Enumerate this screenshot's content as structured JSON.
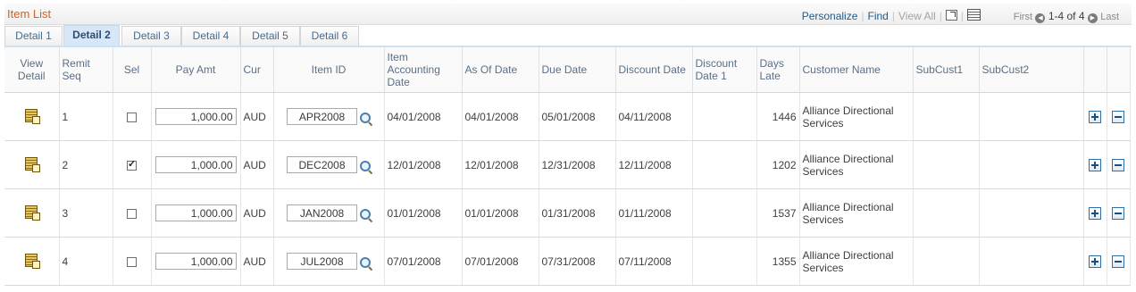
{
  "header": {
    "title": "Item List",
    "personalize": "Personalize",
    "find": "Find",
    "view_all": "View All",
    "first": "First",
    "range": "1-4 of 4",
    "last": "Last"
  },
  "tabs": [
    "Detail 1",
    "Detail 2",
    "Detail 3",
    "Detail 4",
    "Detail 5",
    "Detail 6"
  ],
  "active_tab": "Detail 2",
  "columns": {
    "view_detail": "View Detail",
    "remit_seq": "Remit Seq",
    "sel": "Sel",
    "pay_amt": "Pay Amt",
    "cur": "Cur",
    "item_id": "Item ID",
    "item_acct_date": "Item Accounting Date",
    "as_of_date": "As Of Date",
    "due_date": "Due Date",
    "discount_date": "Discount Date",
    "discount_date_1": "Discount Date 1",
    "days_late": "Days Late",
    "customer_name": "Customer Name",
    "subcust1": "SubCust1",
    "subcust2": "SubCust2"
  },
  "rows": [
    {
      "seq": "1",
      "selected": false,
      "pay_amt": "1,000.00",
      "cur": "AUD",
      "item_id": "APR2008",
      "acct_date": "04/01/2008",
      "as_of": "04/01/2008",
      "due": "05/01/2008",
      "discount": "04/11/2008",
      "discount1": "",
      "days_late": "1446",
      "customer": "Alliance Directional Services",
      "subcust1": "",
      "subcust2": ""
    },
    {
      "seq": "2",
      "selected": true,
      "pay_amt": "1,000.00",
      "cur": "AUD",
      "item_id": "DEC2008",
      "acct_date": "12/01/2008",
      "as_of": "12/01/2008",
      "due": "12/31/2008",
      "discount": "12/11/2008",
      "discount1": "",
      "days_late": "1202",
      "customer": "Alliance Directional Services",
      "subcust1": "",
      "subcust2": ""
    },
    {
      "seq": "3",
      "selected": false,
      "pay_amt": "1,000.00",
      "cur": "AUD",
      "item_id": "JAN2008",
      "acct_date": "01/01/2008",
      "as_of": "01/01/2008",
      "due": "01/31/2008",
      "discount": "01/11/2008",
      "discount1": "",
      "days_late": "1537",
      "customer": "Alliance Directional Services",
      "subcust1": "",
      "subcust2": ""
    },
    {
      "seq": "4",
      "selected": false,
      "pay_amt": "1,000.00",
      "cur": "AUD",
      "item_id": "JUL2008",
      "acct_date": "07/01/2008",
      "as_of": "07/01/2008",
      "due": "07/31/2008",
      "discount": "07/11/2008",
      "discount1": "",
      "days_late": "1355",
      "customer": "Alliance Directional Services",
      "subcust1": "",
      "subcust2": ""
    }
  ],
  "icons": {
    "view_detail": "view-detail-icon",
    "lookup": "lookup-icon",
    "add_row": "add-row-icon",
    "delete_row": "delete-row-icon",
    "zoom": "new-window-icon",
    "download": "download-icon",
    "prev": "previous-arrow-icon",
    "next": "next-arrow-icon"
  },
  "colors": {
    "title": "#d5601e",
    "link": "#1f5b8c",
    "active_tab_bg": "#d8e7f5"
  }
}
